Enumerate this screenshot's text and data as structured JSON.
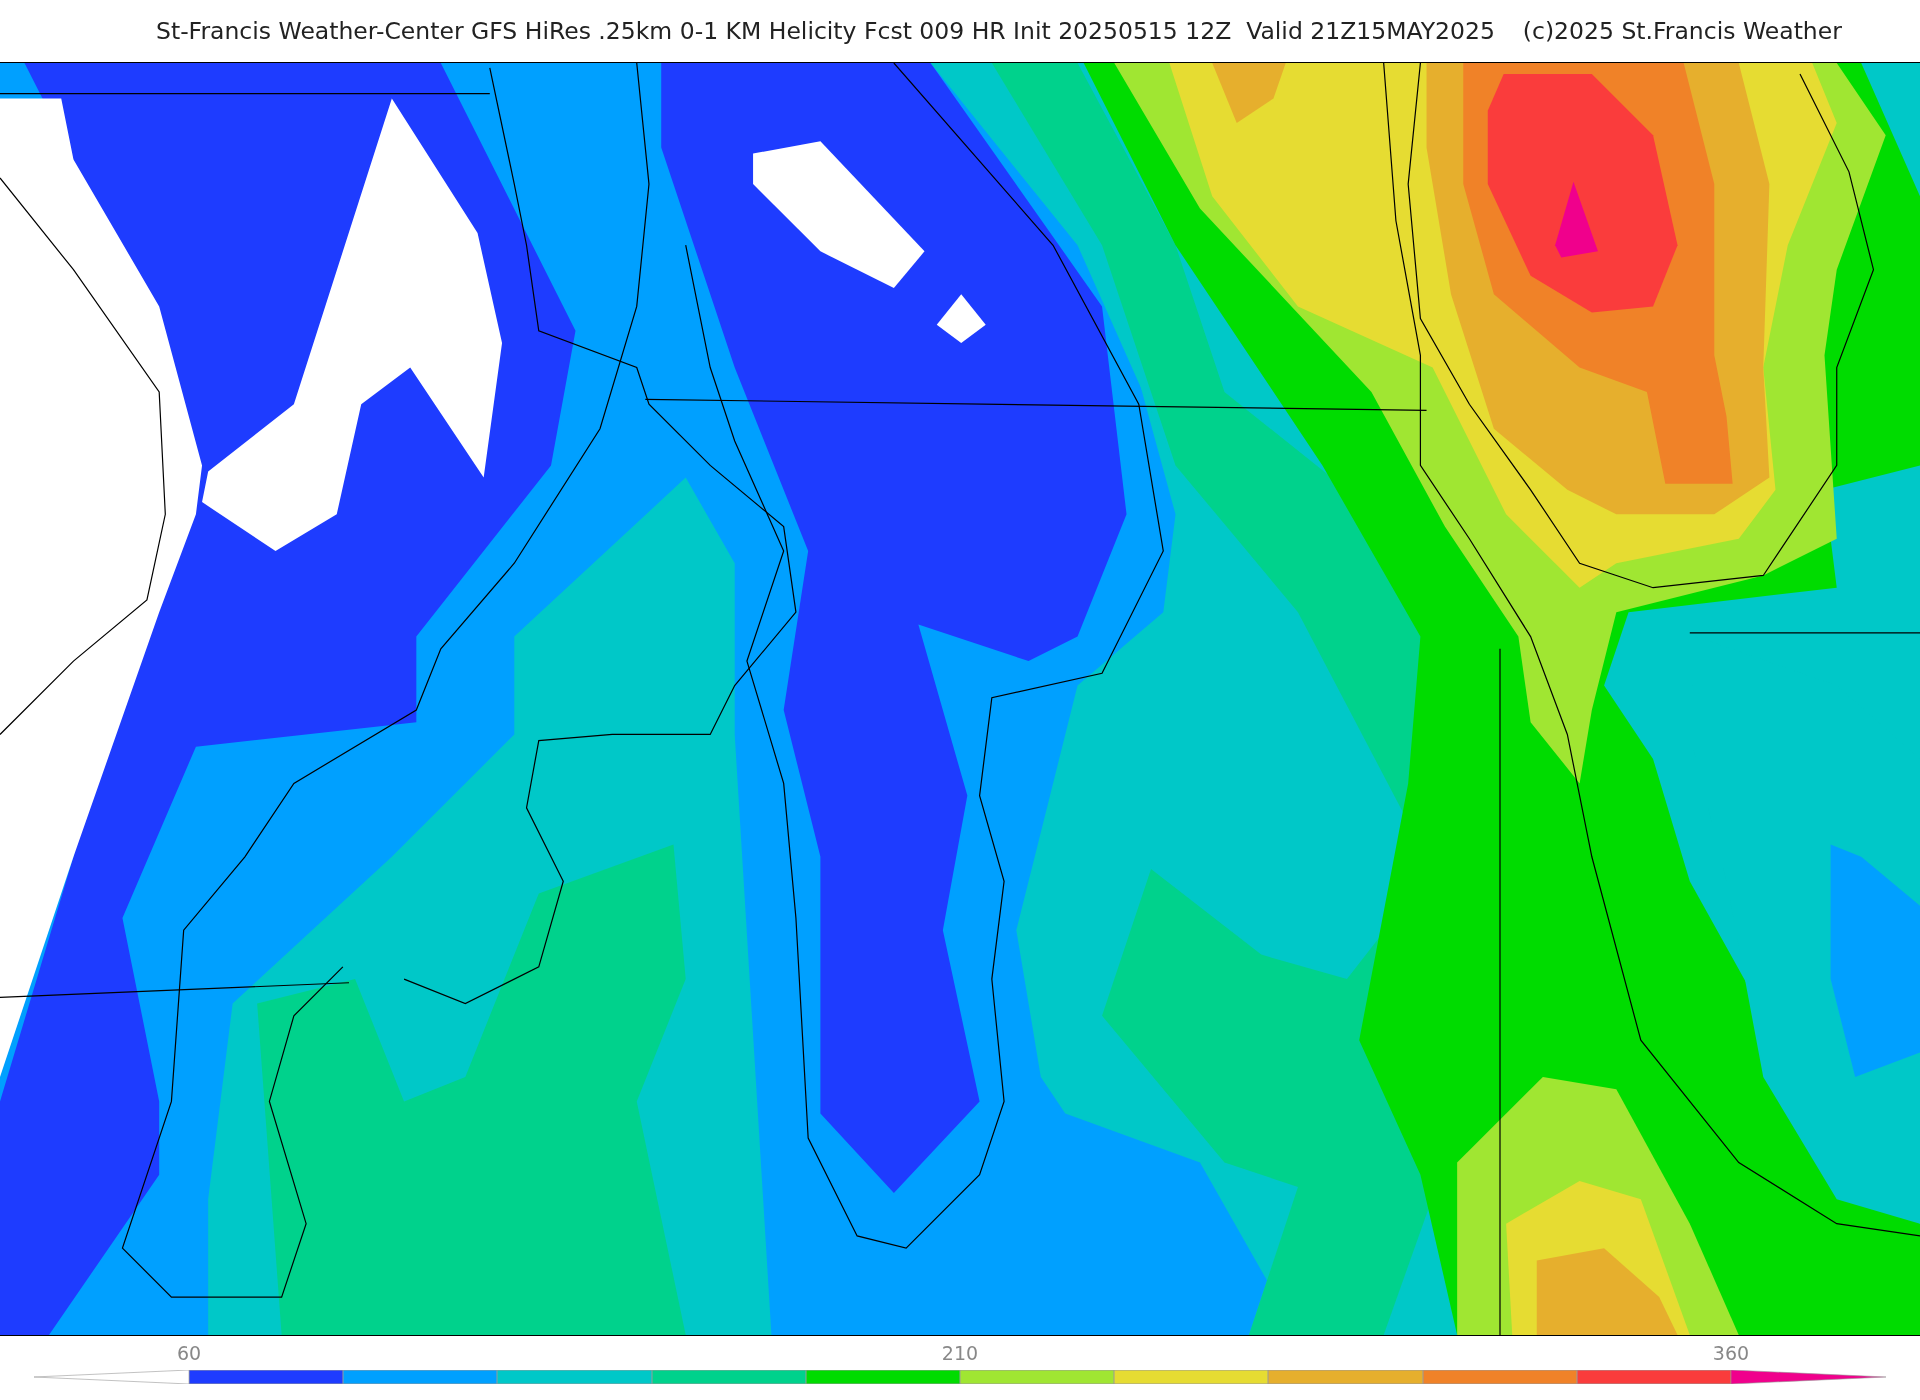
{
  "title": "St-Francis Weather-Center GFS HiRes .25km 0-1 KM Helicity Fcst 009 HR Init 20250515 12Z  Valid 21Z15MAY2025",
  "copyright": "(c)2025 St.Francis Weather",
  "colorbar": {
    "ticks": [
      "60",
      "210",
      "360"
    ],
    "bins": [
      {
        "kind": "under",
        "color": "#ffffff"
      },
      {
        "kind": "bin",
        "color": "#1e3cff"
      },
      {
        "kind": "bin",
        "color": "#00a0ff"
      },
      {
        "kind": "bin",
        "color": "#00c8c8"
      },
      {
        "kind": "bin",
        "color": "#00d28c"
      },
      {
        "kind": "bin",
        "color": "#00dc00"
      },
      {
        "kind": "bin",
        "color": "#a0e632"
      },
      {
        "kind": "bin",
        "color": "#e6dc32"
      },
      {
        "kind": "bin",
        "color": "#e6af2d"
      },
      {
        "kind": "bin",
        "color": "#f08228"
      },
      {
        "kind": "bin",
        "color": "#fa3c3c"
      },
      {
        "kind": "over",
        "color": "#f0008c"
      }
    ]
  }
}
